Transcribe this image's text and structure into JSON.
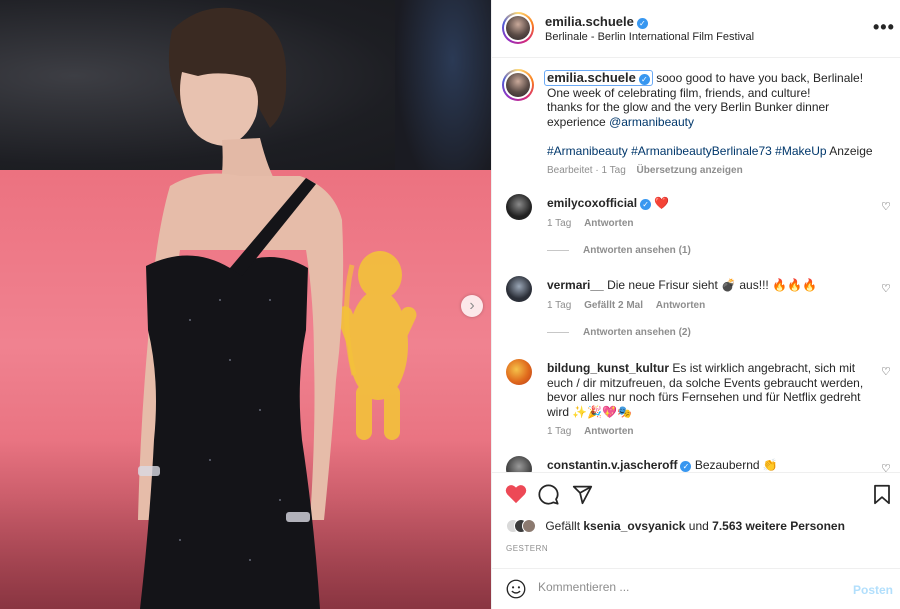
{
  "post": {
    "username": "emilia.schuele",
    "location": "Berlinale - Berlin International Film Festival",
    "more_label": "•••"
  },
  "caption": {
    "username": "emilia.schuele",
    "text_1": "sooo good to have you back, Berlinale! One week of celebrating film, friends, and culture!",
    "text_2": "thanks for the glow and the very Berlin Bunker dinner experience",
    "mention": "@armanibeauty",
    "hashtags": [
      "#Armanibeauty",
      "#ArmanibeautyBerlinale73",
      "#MakeUp"
    ],
    "ad_label": "Anzeige",
    "edited": "Bearbeitet · 1 Tag",
    "translate": "Übersetzung anzeigen"
  },
  "comments": [
    {
      "username": "emilycoxofficial",
      "text": "❤️",
      "time": "1 Tag",
      "likes": "",
      "reply": "Antworten",
      "view_replies": "Antworten ansehen (1)",
      "avatar_color": "#2a2a2a"
    },
    {
      "username": "vermari__",
      "text": "Die neue Frisur sieht 💣 aus!!! 🔥🔥🔥",
      "time": "1 Tag",
      "likes": "Gefällt 2 Mal",
      "reply": "Antworten",
      "view_replies": "Antworten ansehen (2)",
      "avatar_color": "#3b3f4a"
    },
    {
      "username": "bildung_kunst_kultur",
      "text": "Es ist wirklich angebracht, sich mit euch / dir mitzufreuen, da solche Events gebraucht werden, bevor alles nur noch fürs Fernsehen und für Netflix gedreht wird ✨🎉💖🎭",
      "time": "1 Tag",
      "likes": "",
      "reply": "Antworten",
      "view_replies": "",
      "avatar_color": "#e8862a"
    },
    {
      "username": "constantin.v.jascheroff",
      "text": "Bezaubernd 👏",
      "time": "",
      "likes": "",
      "reply": "",
      "view_replies": "",
      "avatar_color": "#555555"
    }
  ],
  "actions": {
    "liked_by_prefix": "Gefällt",
    "liked_by_user": "ksenia_ovsyanick",
    "liked_by_and": "und",
    "liked_by_others": "7.563 weitere Personen",
    "date": "GESTERN"
  },
  "add_comment": {
    "placeholder": "Kommentieren ...",
    "post_label": "Posten"
  },
  "icons": {
    "heart_color": "#ed4956",
    "verified_color": "#3897f0"
  }
}
